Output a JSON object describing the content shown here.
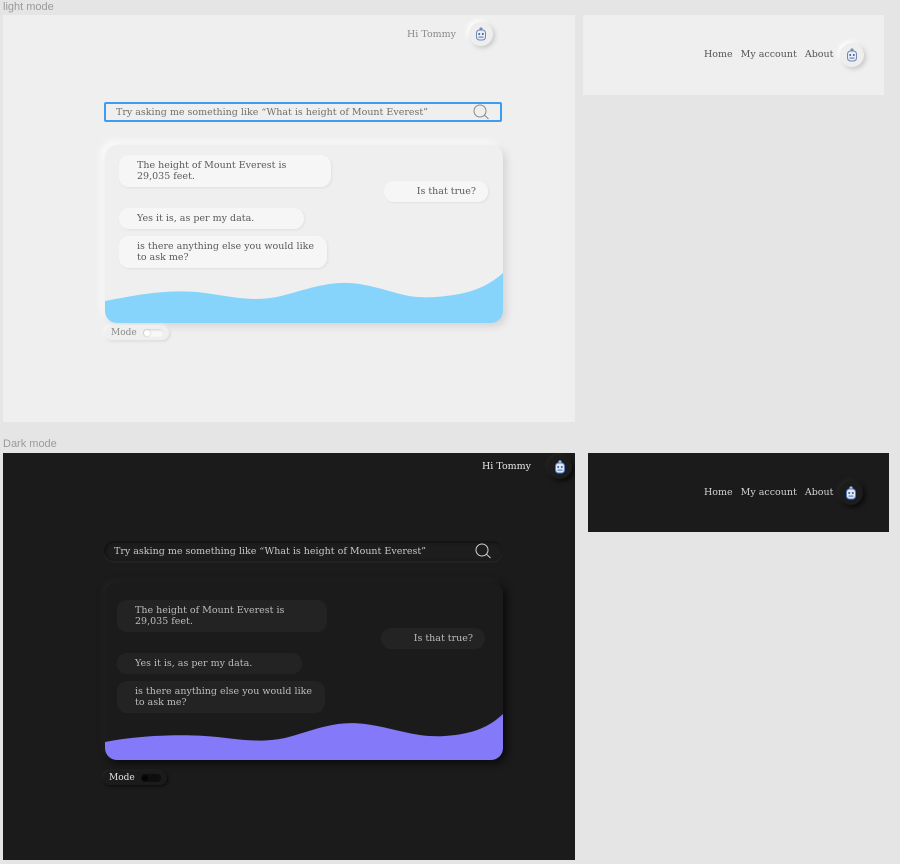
{
  "labels": {
    "light": "light mode",
    "dark": "Dark mode"
  },
  "header": {
    "greeting": "Hi Tommy"
  },
  "nav": {
    "home": "Home",
    "account": "My account",
    "about": "About"
  },
  "search": {
    "placeholder": "Try asking me something like “What is height of Mount Everest”"
  },
  "chat": {
    "m1": "The height of Mount Everest is 29,035 feet.",
    "m2": "Is that true?",
    "m3": "Yes it is, as per my data.",
    "m4": "is there anything else you would like to ask me?"
  },
  "mode": {
    "label": "Mode"
  },
  "colors": {
    "light_wave": "#86d4fb",
    "dark_wave": "#8479f8",
    "search_border": "#3f9bf0"
  },
  "icons": {
    "avatar": "robot-avatar-icon",
    "search": "search-icon"
  }
}
